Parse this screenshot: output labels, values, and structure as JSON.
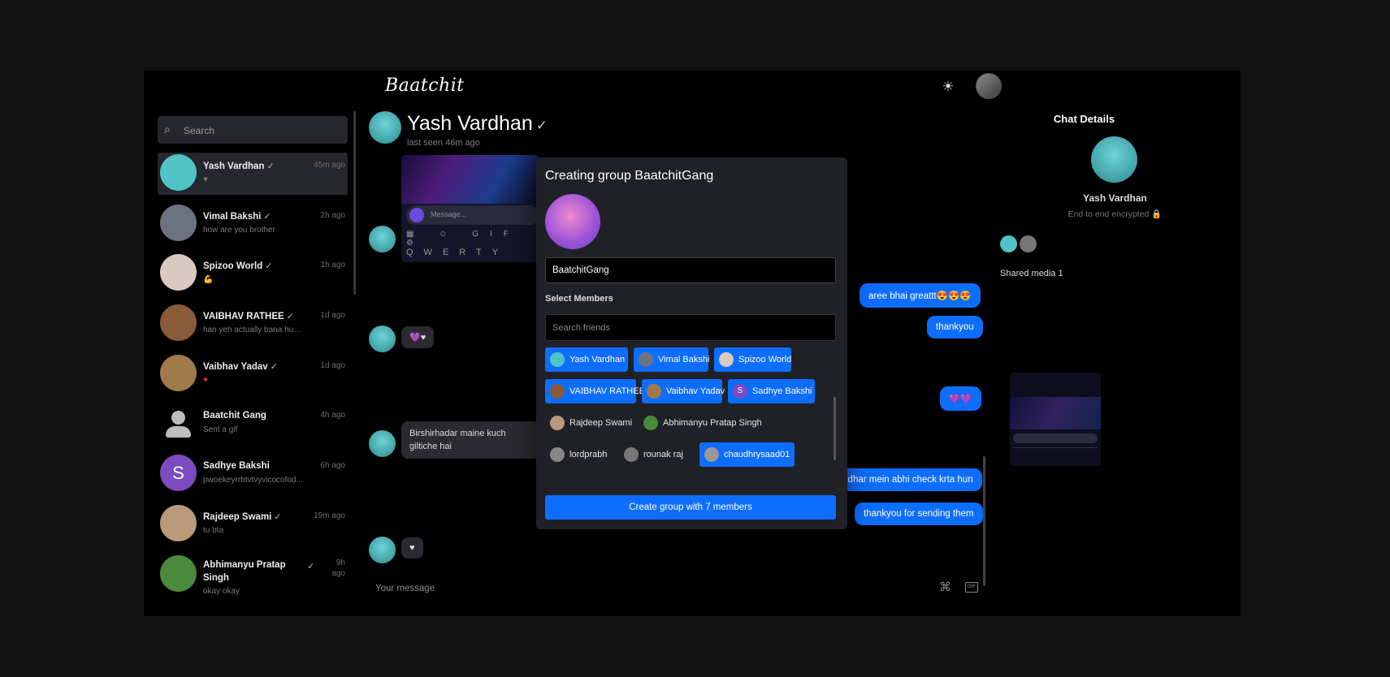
{
  "header": {
    "logo": "Baatchit",
    "theme_icon": "sun-icon",
    "avatar_icon": "user-avatar"
  },
  "sidebar": {
    "search_placeholder": "Search",
    "contacts": [
      {
        "name": "Yash Vardhan",
        "verified": "✓",
        "preview": "♥",
        "time": "45m ago",
        "avatar_color": "#4fc3c6"
      },
      {
        "name": "Vimal Bakshi",
        "verified": "✓",
        "preview": "how are you brother",
        "time": "2h ago",
        "avatar_color": "#6b7280"
      },
      {
        "name": "Spizoo World",
        "verified": "✓",
        "preview": "💪",
        "time": "1h ago",
        "avatar_color": "#d9c9bf"
      },
      {
        "name": "VAIBHAV RATHEE",
        "verified": "✓",
        "preview": "han yeh actually bana hua...",
        "time": "1d ago",
        "avatar_color": "#8a5a3b"
      },
      {
        "name": "Vaibhav Yadav",
        "verified": "✓",
        "preview": "♥",
        "time": "1d ago",
        "avatar_color": "#a07a4a"
      },
      {
        "name": "Baatchit Gang",
        "verified": "",
        "preview": "Sent a gif",
        "time": "4h ago",
        "avatar_color": "#555555"
      },
      {
        "name": "Sadhye Bakshi",
        "verified": "",
        "preview": "pwoekeyrrbtvtvyvicocofod...",
        "time": "6h ago",
        "avatar_color": "#7b4bbf"
      },
      {
        "name": "Rajdeep Swami",
        "verified": "✓",
        "preview": "tu bta",
        "time": "19m ago",
        "avatar_color": "#b89a7a"
      },
      {
        "name": "Abhimanyu Pratap Singh",
        "verified": "✓",
        "preview": "okay okay",
        "time": "9h ago",
        "avatar_color": "#4a8a3a"
      }
    ]
  },
  "chat": {
    "name": "Yash Vardhan",
    "verified": "✓",
    "last_seen": "last seen 46m ago",
    "shot_placeholder": "Message...",
    "shot_keys": "QWERTY",
    "messages_left": [
      {
        "text": "💜♥"
      },
      {
        "text": "Birshirhadar maine kuch giltiche hai"
      },
      {
        "text": "♥"
      }
    ],
    "messages_right": [
      {
        "text": "aree bhai greattt😍😍😍"
      },
      {
        "text": "thankyou"
      },
      {
        "text": "💜💜"
      },
      {
        "text": "idhar mein abhi check krta hun"
      },
      {
        "text": "thankyou for sending them"
      }
    ],
    "input_placeholder": "Your message",
    "attach_icon": "paperclip-icon",
    "gif_label": "GIF"
  },
  "details": {
    "title": "Chat Details",
    "name": "Yash Vardhan",
    "subtitle": "End to end encrypted 🔒",
    "shared_media": "Shared media 1"
  },
  "modal": {
    "title": "Creating group BaatchitGang",
    "group_name": "BaatchitGang",
    "select_label": "Select Members",
    "search_placeholder": "Search friends",
    "members": [
      {
        "name": "Yash Vardhan",
        "selected": true,
        "color": "#4fc3c6"
      },
      {
        "name": "Vimal Bakshi",
        "selected": true,
        "color": "#6b7280"
      },
      {
        "name": "Spizoo World",
        "selected": true,
        "color": "#d9c9bf"
      },
      {
        "name": "VAIBHAV RATHEE",
        "selected": true,
        "color": "#8a5a3b"
      },
      {
        "name": "Vaibhav Yadav",
        "selected": true,
        "color": "#a07a4a"
      },
      {
        "name": "Sadhye Bakshi",
        "selected": true,
        "color": "#7b4bbf"
      },
      {
        "name": "Rajdeep Swami",
        "selected": false,
        "color": "#b89a7a"
      },
      {
        "name": "Abhimanyu Pratap Singh",
        "selected": false,
        "color": "#4a8a3a"
      },
      {
        "name": "lordprabh",
        "selected": false,
        "color": "#888888"
      },
      {
        "name": "rounak raj",
        "selected": false,
        "color": "#777777"
      },
      {
        "name": "chaudhrysaad01",
        "selected": true,
        "color": "#999999"
      }
    ],
    "create_label": "Create group with 7 members"
  }
}
